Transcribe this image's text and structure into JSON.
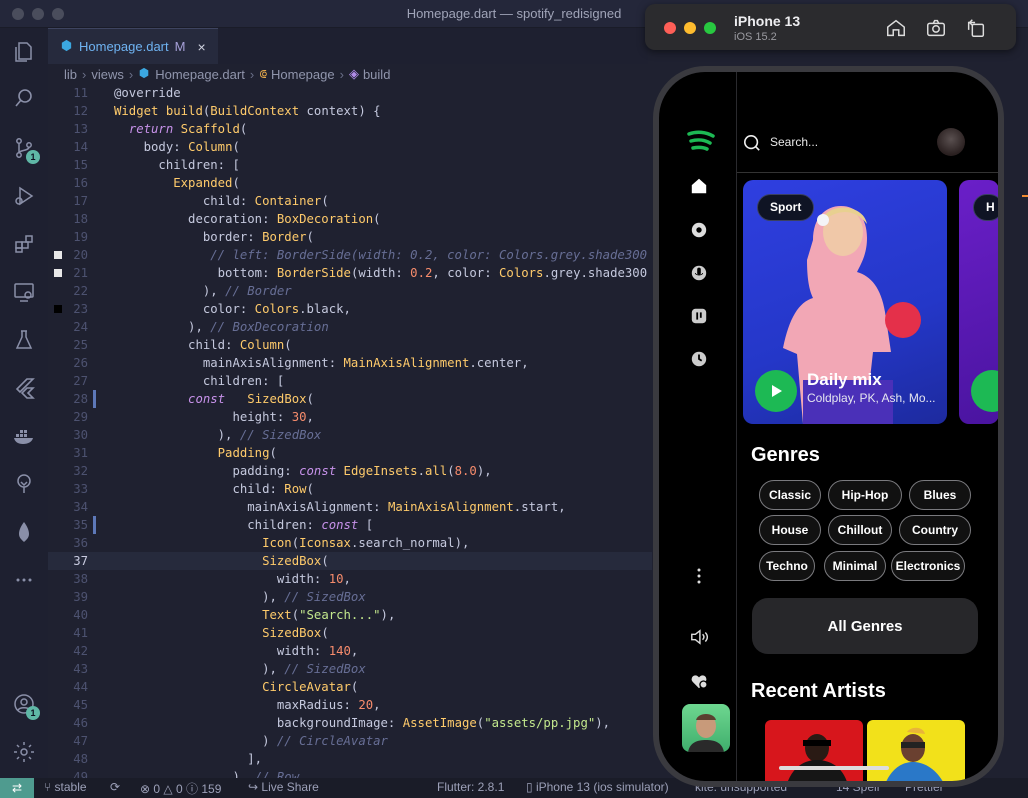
{
  "window": {
    "title": "Homepage.dart — spotify_redisigned"
  },
  "activity_bar": {
    "source_control_badge": "1",
    "accounts_badge": "1"
  },
  "tab": {
    "file": "Homepage.dart",
    "status": "M",
    "close": "×"
  },
  "breadcrumb": {
    "p1": "lib",
    "p2": "views",
    "p3": "Homepage.dart",
    "p4": "Homepage",
    "p5": "build"
  },
  "code": {
    "current_line": 37,
    "lines": [
      {
        "n": "11",
        "html": "<span class='v'>@override</span>"
      },
      {
        "n": "12",
        "html": "<span class='t'>Widget</span> <span class='f'>build</span><span class='v'>(</span><span class='t'>BuildContext</span> <span class='v'>context) {</span>"
      },
      {
        "n": "13",
        "html": "  <span class='i'>return</span> <span class='t'>Scaffold</span><span class='v'>(</span>"
      },
      {
        "n": "14",
        "html": "    <span class='v'>body:</span> <span class='t'>Column</span><span class='v'>(</span>"
      },
      {
        "n": "15",
        "html": "      <span class='v'>children: [</span>"
      },
      {
        "n": "16",
        "html": "        <span class='t'>Expanded</span><span class='v'>(</span>"
      },
      {
        "n": "17",
        "html": "            <span class='v'>child:</span> <span class='t'>Container</span><span class='v'>(</span>"
      },
      {
        "n": "18",
        "html": "          <span class='v'>decoration:</span> <span class='t'>BoxDecoration</span><span class='v'>(</span>"
      },
      {
        "n": "19",
        "html": "            <span class='v'>border:</span> <span class='t'>Border</span><span class='v'>(</span>"
      },
      {
        "n": "20",
        "html": "             <span class='c'>// left: BorderSide(width: 0.2, color: Colors.grey.shade300</span>",
        "mark": "#e8e8e8"
      },
      {
        "n": "21",
        "html": "              <span class='v'>bottom:</span> <span class='t'>BorderSide</span><span class='v'>(width:</span> <span class='n'>0.2</span><span class='v'>, color:</span> <span class='t'>Colors</span><span class='v'>.grey.shade300</span>",
        "mark": "#e8e8e8"
      },
      {
        "n": "22",
        "html": "            <span class='v'>),</span> <span class='c'>// Border</span>"
      },
      {
        "n": "23",
        "html": "            <span class='v'>color:</span> <span class='t'>Colors</span><span class='v'>.black,</span>",
        "mark": "#000000"
      },
      {
        "n": "24",
        "html": "          <span class='v'>),</span> <span class='c'>// BoxDecoration</span>"
      },
      {
        "n": "25",
        "html": "          <span class='v'>child:</span> <span class='t'>Column</span><span class='v'>(</span>"
      },
      {
        "n": "26",
        "html": "            <span class='v'>mainAxisAlignment:</span> <span class='t'>MainAxisAlignment</span><span class='v'>.center,</span>"
      },
      {
        "n": "27",
        "html": "            <span class='v'>children: [</span>"
      },
      {
        "n": "28",
        "html": "          <span class='i'>const</span>   <span class='t'>SizedBox</span><span class='v'>(</span>"
      },
      {
        "n": "29",
        "html": "                <span class='v'>height:</span> <span class='n'>30</span><span class='v'>,</span>"
      },
      {
        "n": "30",
        "html": "              <span class='v'>),</span> <span class='c'>// SizedBox</span>"
      },
      {
        "n": "31",
        "html": "              <span class='t'>Padding</span><span class='v'>(</span>"
      },
      {
        "n": "32",
        "html": "                <span class='v'>padding:</span> <span class='i'>const</span> <span class='t'>EdgeInsets</span><span class='v'>.</span><span class='f'>all</span><span class='v'>(</span><span class='n'>8.0</span><span class='v'>),</span>"
      },
      {
        "n": "33",
        "html": "                <span class='v'>child:</span> <span class='t'>Row</span><span class='v'>(</span>"
      },
      {
        "n": "34",
        "html": "                  <span class='v'>mainAxisAlignment:</span> <span class='t'>MainAxisAlignment</span><span class='v'>.start,</span>"
      },
      {
        "n": "35",
        "html": "                  <span class='v'>children:</span> <span class='i'>const</span> <span class='v'>[</span>"
      },
      {
        "n": "36",
        "html": "                    <span class='t'>Icon</span><span class='v'>(</span><span class='t'>Iconsax</span><span class='v'>.search_normal),</span>"
      },
      {
        "n": "37",
        "html": "                    <span class='t'>SizedBox</span><span class='v'>(</span>"
      },
      {
        "n": "38",
        "html": "                      <span class='v'>width:</span> <span class='n'>10</span><span class='v'>,</span>"
      },
      {
        "n": "39",
        "html": "                    <span class='v'>),</span> <span class='c'>// SizedBox</span>"
      },
      {
        "n": "40",
        "html": "                    <span class='t'>Text</span><span class='v'>(</span><span class='s'>\"Search...\"</span><span class='v'>),</span>"
      },
      {
        "n": "41",
        "html": "                    <span class='t'>SizedBox</span><span class='v'>(</span>"
      },
      {
        "n": "42",
        "html": "                      <span class='v'>width:</span> <span class='n'>140</span><span class='v'>,</span>"
      },
      {
        "n": "43",
        "html": "                    <span class='v'>),</span> <span class='c'>// SizedBox</span>"
      },
      {
        "n": "44",
        "html": "                    <span class='t'>CircleAvatar</span><span class='v'>(</span>"
      },
      {
        "n": "45",
        "html": "                      <span class='v'>maxRadius:</span> <span class='n'>20</span><span class='v'>,</span>"
      },
      {
        "n": "46",
        "html": "                      <span class='v'>backgroundImage:</span> <span class='t'>AssetImage</span><span class='v'>(</span><span class='s'>\"assets/pp.jpg\"</span><span class='v'>),</span>"
      },
      {
        "n": "47",
        "html": "                    <span class='v'>)</span> <span class='c'>// CircleAvatar</span>"
      },
      {
        "n": "48",
        "html": "                  <span class='v'>],</span>"
      },
      {
        "n": "49",
        "html": "                <span class='v'>),</span> <span class='c'>// Row</span>"
      }
    ]
  },
  "status_bar": {
    "branch": "stable",
    "errors": "0",
    "warnings": "0",
    "info": "159",
    "live_share": "Live Share",
    "flutter": "Flutter: 2.8.1",
    "device": "iPhone 13 (ios simulator)",
    "kite": "kite: unsupported",
    "spell": "14 Spell",
    "prettier": "Prettier"
  },
  "simulator": {
    "device": "iPhone 13",
    "os": "iOS 15.2",
    "colors": {
      "close": "#fe5f57",
      "min": "#febc2e",
      "max": "#28c840"
    }
  },
  "app": {
    "search_placeholder": "Search...",
    "card_tag": "Sport",
    "card2_tag": "H",
    "mix_title": "Daily mix",
    "mix_subtitle": "Coldplay, PK, Ash, Mo...",
    "genres_title": "Genres",
    "genres": [
      "Classic",
      "Hip-Hop",
      "Blues",
      "House",
      "Chillout",
      "Country",
      "Techno",
      "Minimal",
      "Electronics"
    ],
    "all_genres": "All Genres",
    "recent_artists_title": "Recent Artists",
    "accent": "#1db954"
  }
}
